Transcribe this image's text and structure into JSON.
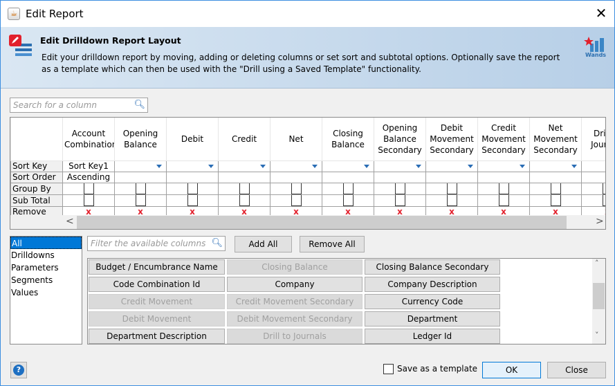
{
  "window": {
    "title": "Edit Report"
  },
  "header": {
    "title": "Edit Drilldown Report Layout",
    "description": "Edit your drilldown report by moving, adding or deleting columns or set sort and subtotal options. Optionally save the report as a template which can then be used with the \"Drill using a Saved Template\" functionality.",
    "logo_text": "Wands"
  },
  "search": {
    "placeholder": "Search for a column"
  },
  "grid": {
    "row_labels": [
      "Sort Key",
      "Sort Order",
      "Group By",
      "Sub Total",
      "Remove"
    ],
    "columns": [
      {
        "name": "Account Combination",
        "sort_key": "Sort Key1",
        "sort_order": "Ascending"
      },
      {
        "name": "Opening Balance"
      },
      {
        "name": "Debit"
      },
      {
        "name": "Credit"
      },
      {
        "name": "Net"
      },
      {
        "name": "Closing Balance"
      },
      {
        "name": "Opening Balance Secondary"
      },
      {
        "name": "Debit Movement Secondary"
      },
      {
        "name": "Credit Movement Secondary"
      },
      {
        "name": "Net Movement Secondary"
      },
      {
        "name": "Drill to Journals"
      }
    ],
    "remove_glyph": "x"
  },
  "categories": {
    "items": [
      "All",
      "Drilldowns",
      "Parameters",
      "Segments",
      "Values"
    ],
    "selected": "All"
  },
  "filter": {
    "placeholder": "Filter the available columns"
  },
  "buttons": {
    "add_all": "Add All",
    "remove_all": "Remove All",
    "ok": "OK",
    "close": "Close",
    "help": "?"
  },
  "available_columns": [
    {
      "label": "Budget / Encumbrance Name",
      "enabled": true
    },
    {
      "label": "Closing Balance",
      "enabled": false
    },
    {
      "label": "Closing Balance Secondary",
      "enabled": true
    },
    {
      "label": "Code Combination Id",
      "enabled": true
    },
    {
      "label": "Company",
      "enabled": true
    },
    {
      "label": "Company Description",
      "enabled": true
    },
    {
      "label": "Credit Movement",
      "enabled": false
    },
    {
      "label": "Credit Movement Secondary",
      "enabled": false
    },
    {
      "label": "Currency Code",
      "enabled": true
    },
    {
      "label": "Debit Movement",
      "enabled": false
    },
    {
      "label": "Debit Movement Secondary",
      "enabled": false
    },
    {
      "label": "Department",
      "enabled": true
    },
    {
      "label": "Department Description",
      "enabled": true
    },
    {
      "label": "Drill to Journals",
      "enabled": false
    },
    {
      "label": "Ledger Id",
      "enabled": true
    }
  ],
  "save_template": {
    "label": "Save as a template",
    "checked": false
  }
}
